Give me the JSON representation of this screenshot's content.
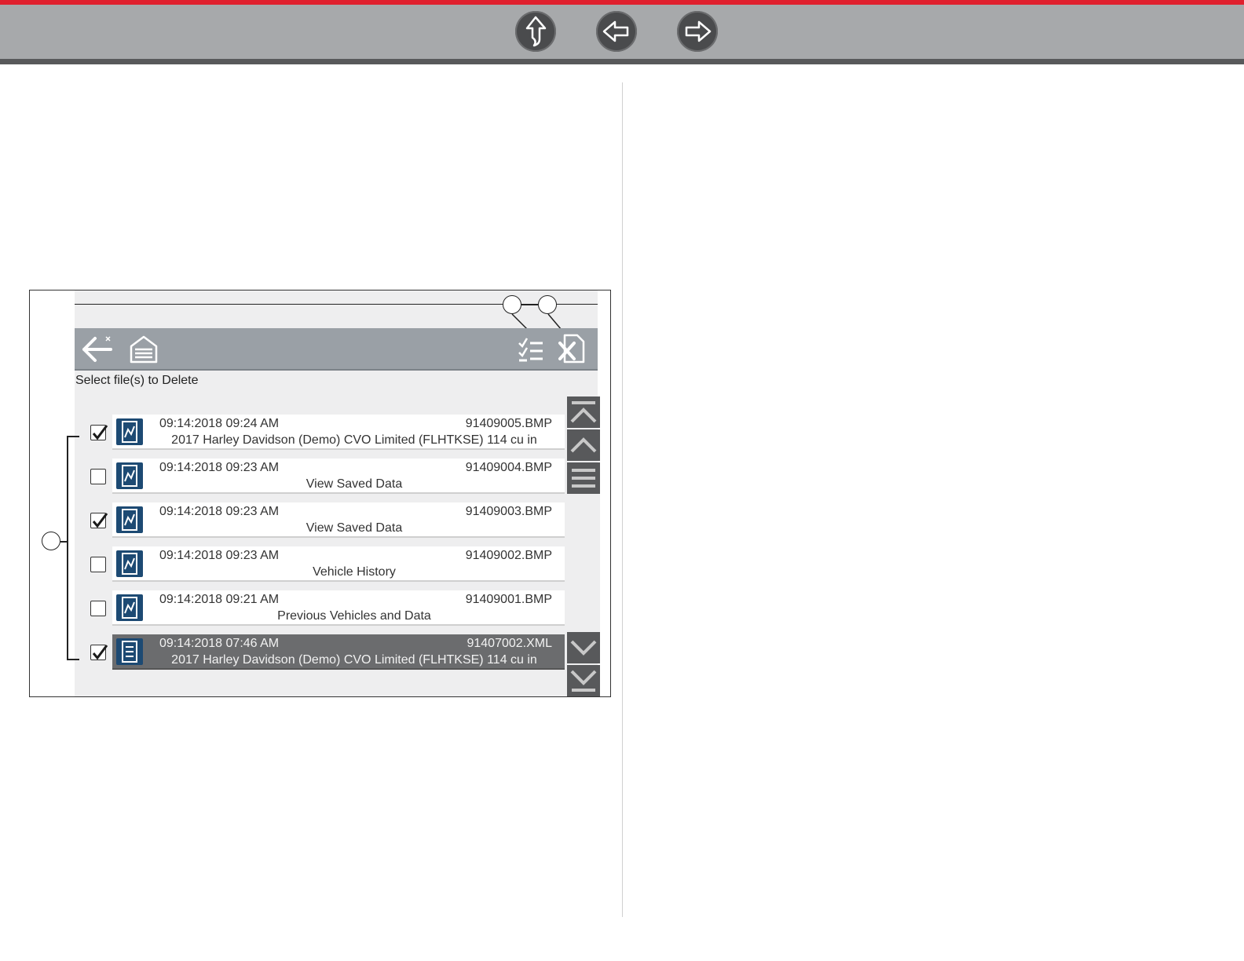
{
  "nav": {
    "buttons": [
      {
        "name": "up-arrow-icon"
      },
      {
        "name": "back-arrow-icon"
      },
      {
        "name": "forward-arrow-icon"
      }
    ]
  },
  "screen": {
    "instruction": "Select file(s) to Delete",
    "toolbar": {
      "back": "back-arrow-icon",
      "home": "garage-home-icon",
      "select_all": "select-all-icon",
      "delete": "delete-file-icon"
    },
    "files": [
      {
        "datetime": "09:14:2018 09:24 AM",
        "filename": "91409005.BMP",
        "description": "2017 Harley Davidson (Demo) CVO Limited (FLHTKSE) 114 cu in",
        "checked": true,
        "selected": false,
        "type": "image"
      },
      {
        "datetime": "09:14:2018 09:23 AM",
        "filename": "91409004.BMP",
        "description": "View Saved Data",
        "checked": false,
        "selected": false,
        "type": "image"
      },
      {
        "datetime": "09:14:2018 09:23 AM",
        "filename": "91409003.BMP",
        "description": "View Saved Data",
        "checked": true,
        "selected": false,
        "type": "image"
      },
      {
        "datetime": "09:14:2018 09:23 AM",
        "filename": "91409002.BMP",
        "description": "Vehicle History",
        "checked": false,
        "selected": false,
        "type": "image"
      },
      {
        "datetime": "09:14:2018 09:21 AM",
        "filename": "91409001.BMP",
        "description": "Previous Vehicles and Data",
        "checked": false,
        "selected": false,
        "type": "image"
      },
      {
        "datetime": "09:14:2018 07:46 AM",
        "filename": "91407002.XML",
        "description": "2017 Harley Davidson (Demo) CVO Limited (FLHTKSE) 114 cu in",
        "checked": true,
        "selected": true,
        "type": "xml"
      }
    ],
    "scroll": [
      "scroll-top-icon",
      "scroll-up-icon",
      "scroll-menu-icon",
      "scroll-down-icon",
      "scroll-bottom-icon"
    ]
  },
  "colors": {
    "accent_red": "#e0202e",
    "toolbar_gray": "#9aa0a6",
    "file_icon_blue": "#1d4a73",
    "selected_row": "#6b6c6e"
  }
}
